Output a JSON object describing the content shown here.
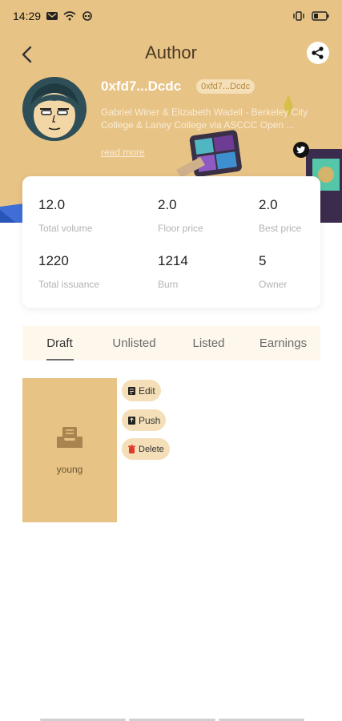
{
  "status": {
    "time": "14:29"
  },
  "nav": {
    "title": "Author"
  },
  "author": {
    "name": "0xfd7...Dcdc",
    "address_badge": "0xfd7...Dcdc",
    "description": "Gabriel Winer & Elizabeth Wadell - Berkeley City College & Laney College via ASCCC Open ...",
    "read_more": "read more"
  },
  "stats": [
    {
      "value": "12.0",
      "label": "Total volume"
    },
    {
      "value": "2.0",
      "label": "Floor price"
    },
    {
      "value": "2.0",
      "label": "Best price"
    },
    {
      "value": "1220",
      "label": "Total issuance"
    },
    {
      "value": "1214",
      "label": "Burn"
    },
    {
      "value": "5",
      "label": "Owner"
    }
  ],
  "tabs": [
    {
      "label": "Draft",
      "active": true
    },
    {
      "label": "Unlisted",
      "active": false
    },
    {
      "label": "Listed",
      "active": false
    },
    {
      "label": "Earnings",
      "active": false
    }
  ],
  "draft_item": {
    "name": "young"
  },
  "actions": {
    "edit": "Edit",
    "push": "Push",
    "delete": "Delete"
  },
  "colors": {
    "header": "#e8c386",
    "badge": "#f4dfb8",
    "delete_icon": "#e03a2f"
  },
  "icons": [
    "back-arrow-icon",
    "share-icon",
    "twitter-icon",
    "inbox-icon",
    "edit-icon",
    "push-icon",
    "delete-icon"
  ]
}
